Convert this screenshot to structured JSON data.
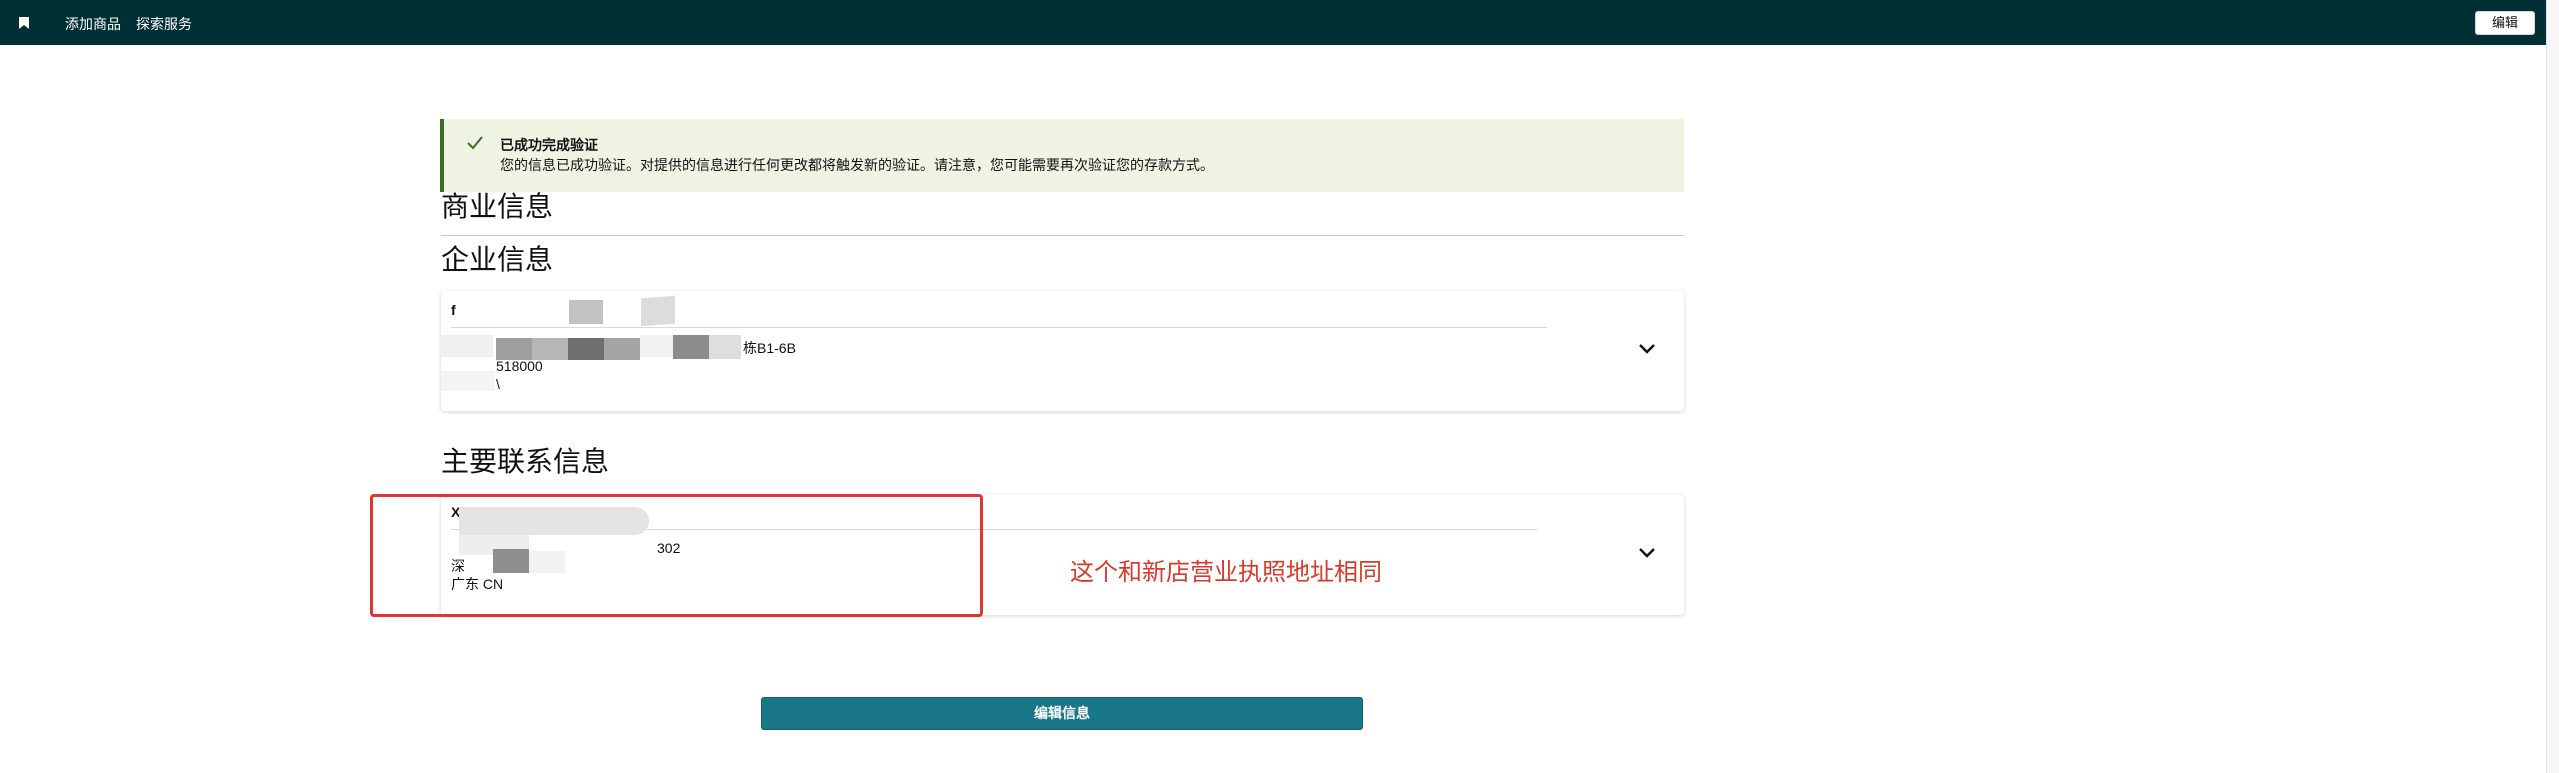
{
  "topbar": {
    "background": "#002f36",
    "icon": "bookmark-icon",
    "nav": [
      "添加商品",
      "探索服务"
    ],
    "edit_label": "编辑"
  },
  "banner": {
    "icon": "check-icon",
    "title": "已成功完成验证",
    "message": "您的信息已成功验证。对提供的信息进行任何更改都将触发新的验证。请注意，您可能需要再次验证您的存款方式。",
    "background": "#eff4e2",
    "accent": "#3a6c24"
  },
  "sections": {
    "business_info": "商业信息",
    "company_info": "企业信息",
    "primary_contact": "主要联系信息"
  },
  "company_card": {
    "name_line": "f",
    "address_line": "栋B1-6B",
    "postal_line": "518000",
    "region_line": "\\",
    "expand_icon": "chevron-down-icon"
  },
  "contact_card": {
    "name_line": "X",
    "address_line": "302",
    "postal_line": "深",
    "region_line": "广东 CN",
    "expand_icon": "chevron-down-icon"
  },
  "annotation": {
    "note": "这个和新店营业执照地址相同",
    "color": "#d93a2b"
  },
  "footer": {
    "edit_info_label": "编辑信息",
    "button_color": "#1a7689"
  }
}
